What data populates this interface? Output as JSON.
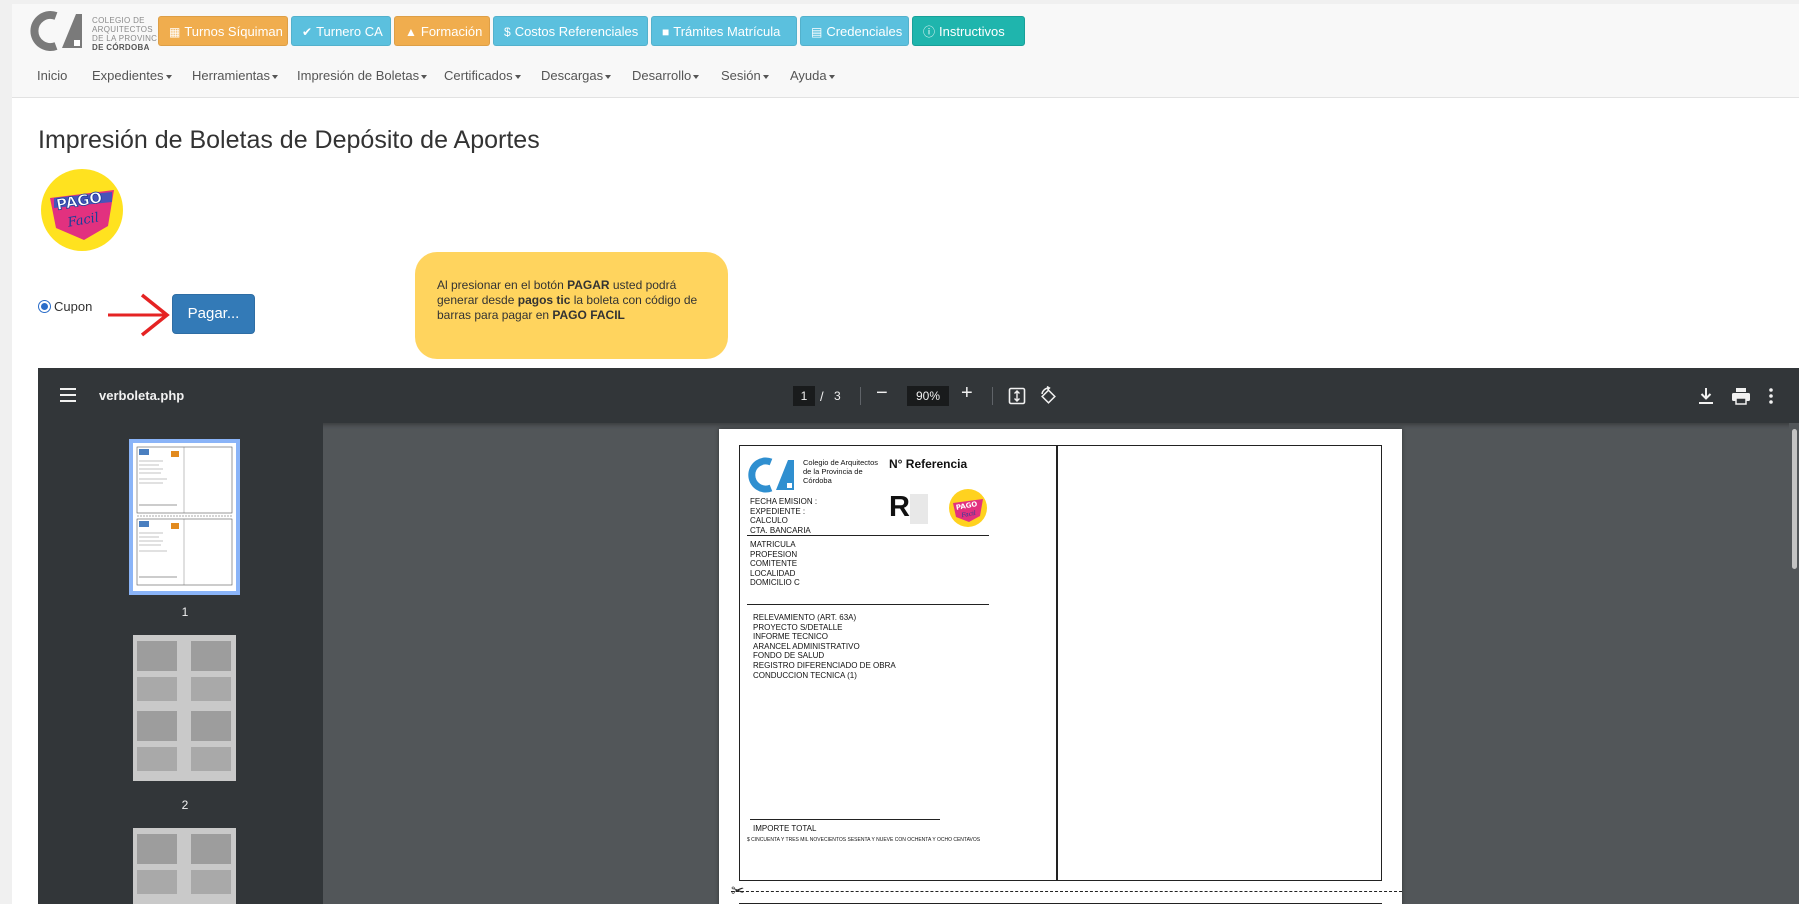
{
  "header": {
    "logo_text": [
      "COLEGIO DE",
      "ARQUITECTOS",
      "DE LA PROVINCIA",
      "DE CÓRDOBA"
    ],
    "buttons": [
      {
        "label": "Turnos Síquiman",
        "icon": "grid-icon",
        "color": "#f0ad4e"
      },
      {
        "label": "Turnero CA",
        "icon": "check-circle-icon",
        "color": "#5bc0de"
      },
      {
        "label": "Formación",
        "icon": "graduation-cap-icon",
        "color": "#f0ad4e"
      },
      {
        "label": "Costos Referenciales",
        "icon": "dollar-icon",
        "color": "#5bc0de"
      },
      {
        "label": "Trámites Matrícula",
        "icon": "user-icon",
        "color": "#5bc0de"
      },
      {
        "label": "Credenciales",
        "icon": "card-icon",
        "color": "#5bc0de"
      },
      {
        "label": "Instructivos",
        "icon": "info-icon",
        "color": "#1fb5ad"
      }
    ]
  },
  "nav": [
    {
      "label": "Inicio",
      "dropdown": false
    },
    {
      "label": "Expedientes",
      "dropdown": true
    },
    {
      "label": "Herramientas",
      "dropdown": true
    },
    {
      "label": "Impresión de Boletas",
      "dropdown": true
    },
    {
      "label": "Certificados",
      "dropdown": true
    },
    {
      "label": "Descargas",
      "dropdown": true
    },
    {
      "label": "Desarrollo",
      "dropdown": true
    },
    {
      "label": "Sesión",
      "dropdown": true
    },
    {
      "label": "Ayuda",
      "dropdown": true
    }
  ],
  "main": {
    "title": "Impresión de Boletas de Depósito de Aportes",
    "radio_label": "Cupon",
    "radio_checked": true,
    "pay_button": "Pagar...",
    "note": {
      "t1": "Al presionar en el botón ",
      "b1": "PAGAR",
      "t2": " usted podrá generar desde ",
      "b2": "pagos tic",
      "t3": " la boleta con código de barras para pagar en ",
      "b3": "PAGO FACIL"
    }
  },
  "viewer": {
    "filename": "verboleta.php",
    "current_page": "1",
    "slash": "/",
    "total_pages": "3",
    "zoom": "90%",
    "thumbnails": [
      {
        "label": "1"
      },
      {
        "label": "2"
      }
    ],
    "document": {
      "org_name": [
        "Colegio de Arquitectos",
        "de la Provincia de",
        "Córdoba"
      ],
      "ref_title": "N° Referencia",
      "ref_letter": "R",
      "header_fields": [
        "FECHA EMISION :",
        "EXPEDIENTE :",
        "CALCULO",
        "CTA. BANCARIA"
      ],
      "person_fields": [
        "MATRICULA",
        "PROFESION",
        "COMITENTE",
        "LOCALIDAD",
        "DOMICILIO C"
      ],
      "items": [
        "RELEVAMIENTO (ART. 63A)",
        "PROYECTO S/DETALLE",
        "INFORME TECNICO",
        "ARANCEL ADMINISTRATIVO",
        "FONDO DE SALUD",
        "REGISTRO DIFERENCIADO DE OBRA",
        "CONDUCCION TECNICA (1)"
      ],
      "total_label": "IMPORTE TOTAL",
      "total_words": "$ CINCUENTA Y TRES MIL NOVECIENTOS SESENTA Y NUEVE CON OCHENTA Y OCHO CENTAVOS"
    }
  }
}
